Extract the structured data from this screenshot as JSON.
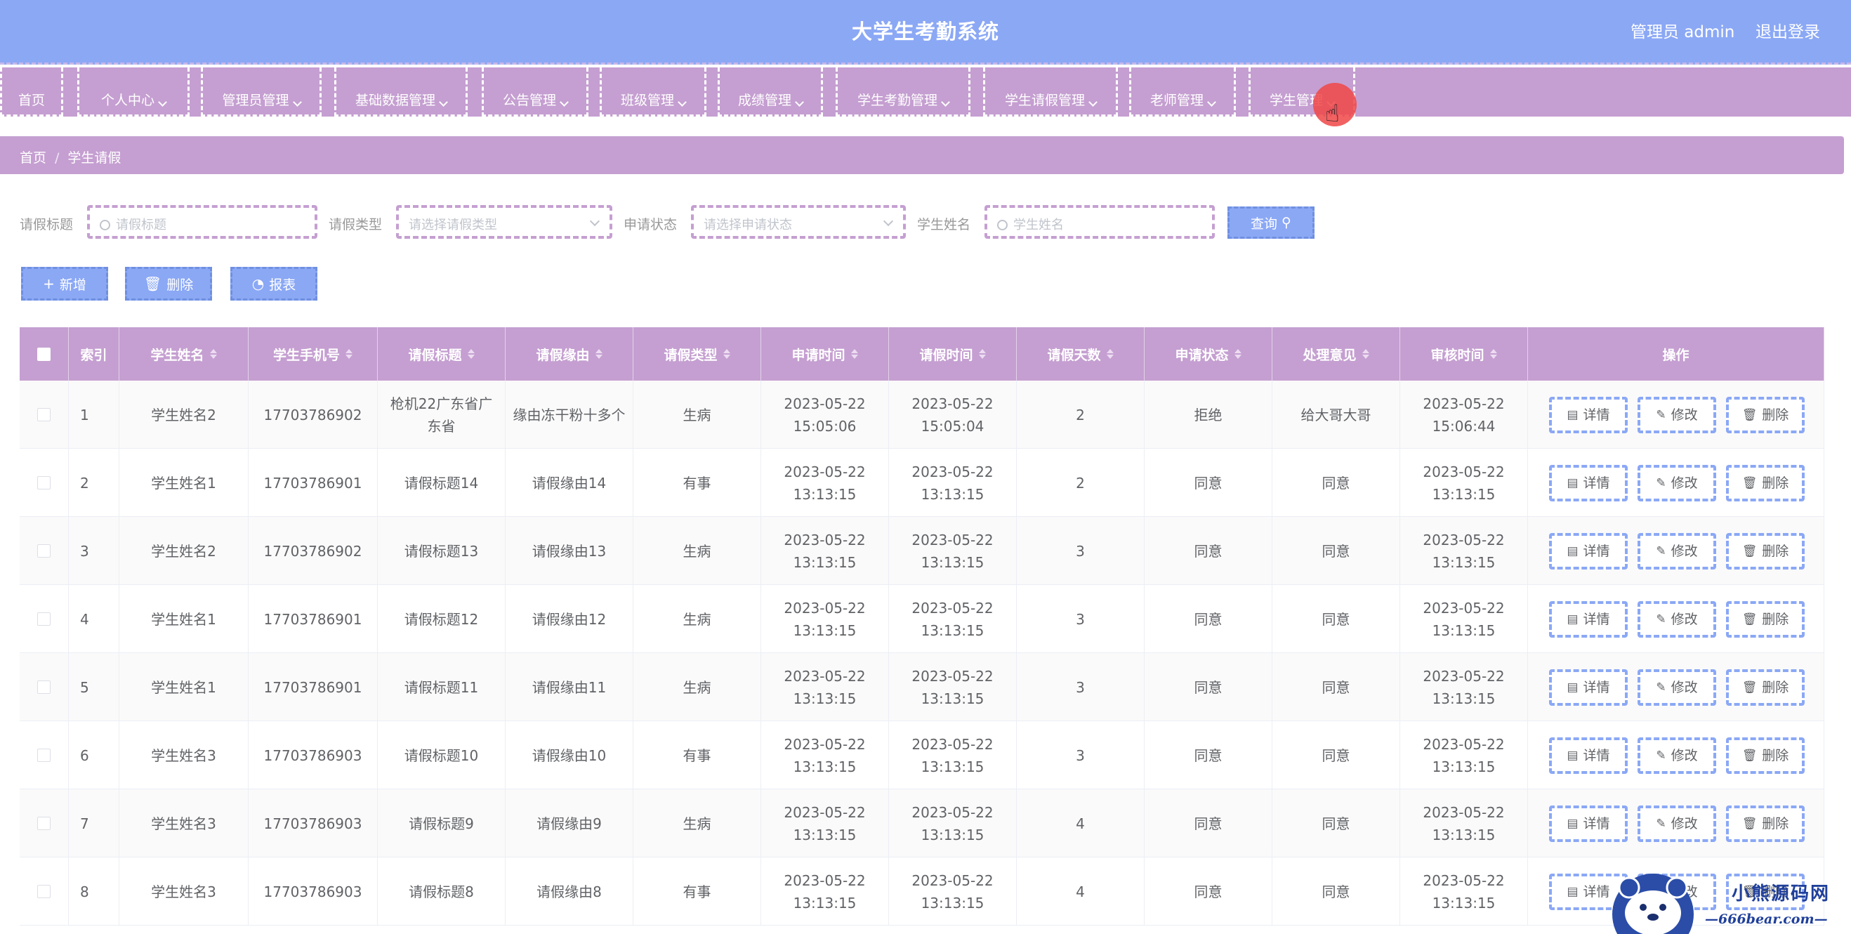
{
  "header": {
    "title": "大学生考勤系统",
    "admin": "管理员 admin",
    "logout": "退出登录"
  },
  "nav": [
    "首页",
    "个人中心",
    "管理员管理",
    "基础数据管理",
    "公告管理",
    "班级管理",
    "成绩管理",
    "学生考勤管理",
    "学生请假管理",
    "老师管理",
    "学生管理"
  ],
  "breadcrumb": {
    "home": "首页",
    "sep": "/",
    "current": "学生请假"
  },
  "search": {
    "title_label": "请假标题",
    "title_placeholder": "请假标题",
    "type_label": "请假类型",
    "type_placeholder": "请选择请假类型",
    "status_label": "申请状态",
    "status_placeholder": "请选择申请状态",
    "name_label": "学生姓名",
    "name_placeholder": "学生姓名",
    "query_label": "查询"
  },
  "actions": {
    "add": "新增",
    "delete": "删除",
    "report": "报表"
  },
  "table": {
    "columns": [
      "索引",
      "学生姓名",
      "学生手机号",
      "请假标题",
      "请假缘由",
      "请假类型",
      "申请时间",
      "请假时间",
      "请假天数",
      "申请状态",
      "处理意见",
      "审核时间",
      "操作"
    ],
    "op_labels": {
      "detail": "详情",
      "edit": "修改",
      "delete": "删除"
    },
    "rows": [
      [
        "1",
        "学生姓名2",
        "17703786902",
        "枪机22广东省广东省",
        "缘由冻干粉十多个",
        "生病",
        "2023-05-22 15:05:06",
        "2023-05-22 15:05:04",
        "2",
        "拒绝",
        "给大哥大哥",
        "2023-05-22 15:06:44"
      ],
      [
        "2",
        "学生姓名1",
        "17703786901",
        "请假标题14",
        "请假缘由14",
        "有事",
        "2023-05-22 13:13:15",
        "2023-05-22 13:13:15",
        "2",
        "同意",
        "同意",
        "2023-05-22 13:13:15"
      ],
      [
        "3",
        "学生姓名2",
        "17703786902",
        "请假标题13",
        "请假缘由13",
        "生病",
        "2023-05-22 13:13:15",
        "2023-05-22 13:13:15",
        "3",
        "同意",
        "同意",
        "2023-05-22 13:13:15"
      ],
      [
        "4",
        "学生姓名1",
        "17703786901",
        "请假标题12",
        "请假缘由12",
        "生病",
        "2023-05-22 13:13:15",
        "2023-05-22 13:13:15",
        "3",
        "同意",
        "同意",
        "2023-05-22 13:13:15"
      ],
      [
        "5",
        "学生姓名1",
        "17703786901",
        "请假标题11",
        "请假缘由11",
        "生病",
        "2023-05-22 13:13:15",
        "2023-05-22 13:13:15",
        "3",
        "同意",
        "同意",
        "2023-05-22 13:13:15"
      ],
      [
        "6",
        "学生姓名3",
        "17703786903",
        "请假标题10",
        "请假缘由10",
        "有事",
        "2023-05-22 13:13:15",
        "2023-05-22 13:13:15",
        "3",
        "同意",
        "同意",
        "2023-05-22 13:13:15"
      ],
      [
        "7",
        "学生姓名3",
        "17703786903",
        "请假标题9",
        "请假缘由9",
        "生病",
        "2023-05-22 13:13:15",
        "2023-05-22 13:13:15",
        "4",
        "同意",
        "同意",
        "2023-05-22 13:13:15"
      ],
      [
        "8",
        "学生姓名3",
        "17703786903",
        "请假标题8",
        "请假缘由8",
        "有事",
        "2023-05-22 13:13:15",
        "2023-05-22 13:13:15",
        "4",
        "同意",
        "同意",
        "2023-05-22 13:13:15"
      ]
    ]
  },
  "watermark": {
    "line1": "小熊源码网",
    "line2": "—666bear.com—"
  },
  "colors": {
    "header": "#8ba8f5",
    "accent": "#c59fd1",
    "button": "#8ba8f5",
    "cursor_marker": "#f04646"
  }
}
